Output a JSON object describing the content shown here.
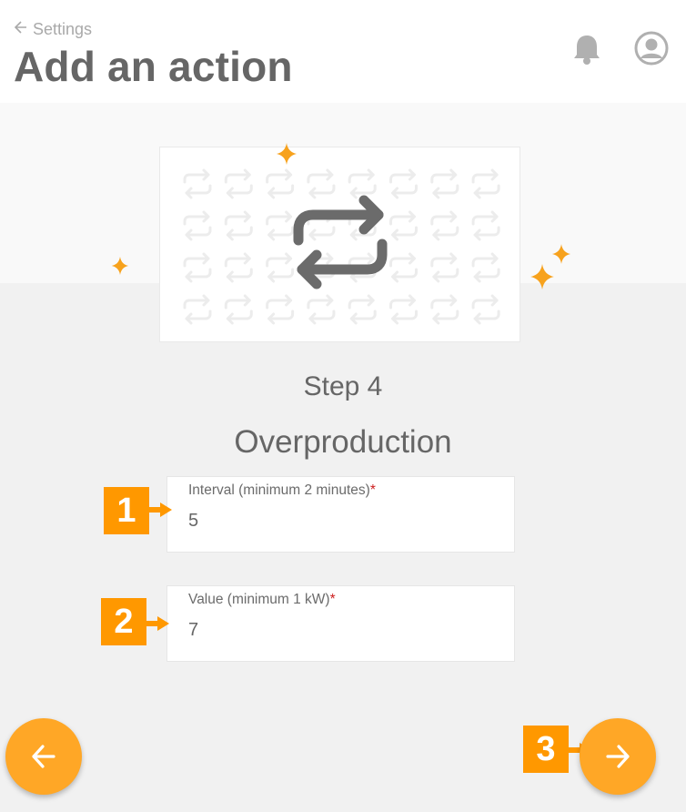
{
  "header": {
    "back_label": "Settings",
    "title": "Add an action",
    "icons": [
      "back-arrow-icon",
      "bell-icon",
      "user-avatar-icon"
    ]
  },
  "illustration": {
    "icon": "repeat-icon",
    "pattern_icon": "repeat-icon",
    "accent_color": "#f7a21d"
  },
  "step": {
    "label": "Step 4",
    "title": "Overproduction"
  },
  "form": {
    "interval": {
      "label": "Interval (minimum 2 minutes)",
      "required_mark": "*",
      "value": "5"
    },
    "value": {
      "label": "Value (minimum 1 kW)",
      "required_mark": "*",
      "value": "7"
    }
  },
  "callouts": [
    "1",
    "2",
    "3"
  ],
  "nav": {
    "prev_icon": "arrow-left-icon",
    "next_icon": "arrow-right-icon",
    "button_color": "#ffa726"
  },
  "colors": {
    "accent": "#ff9800",
    "required": "#cc1d1d",
    "text": "#666666"
  }
}
